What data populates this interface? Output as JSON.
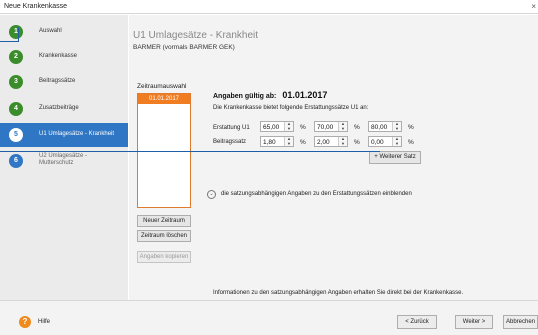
{
  "window": {
    "title": "Neue Krankenkasse",
    "close_glyph": "×"
  },
  "sidebar": {
    "items": [
      {
        "num": "1",
        "label": "Auswahl"
      },
      {
        "num": "2",
        "label": "Krankenkasse"
      },
      {
        "num": "3",
        "label": "Beitragssätze"
      },
      {
        "num": "4",
        "label": "Zusatzbeiträge"
      },
      {
        "num": "5",
        "label": "U1 Umlagesätze - Krankheit"
      },
      {
        "num": "6",
        "label": "U2 Umlagesätze - Mutterschutz"
      }
    ]
  },
  "main": {
    "title": "U1 Umlagesätze - Krankheit",
    "subtitle": "BARMER (vormals BARMER GEK)",
    "period_label": "Zeitraumauswahl",
    "periods": [
      "01.01.2017"
    ],
    "new_period_button": "Neuer Zeitraum",
    "delete_period_button": "Zeitraum löschen",
    "copy_values_button": "Angaben kopieren",
    "valid_from_label": "Angaben gültig ab:",
    "valid_from_date": "01.01.2017",
    "description": "Die Krankenkasse bietet folgende Erstattungssätze U1 an:",
    "erstattung_label": "Erstattung U1",
    "beitrag_label": "Beitragssatz",
    "erstattung_values": [
      "65,00",
      "70,00",
      "80,00"
    ],
    "beitrag_values": [
      "1,80",
      "2,00",
      "0,00"
    ],
    "percent_sign": "%",
    "add_rate_button": "+ Weiterer Satz",
    "expander_text": "die satzungsabhängigen Angaben zu den Erstattungssätzen einblenden",
    "info_text": "Informationen zu den satzungsabhängigen Angaben erhalten Sie direkt bei der Krankenkasse."
  },
  "footer": {
    "help_label": "Hilfe",
    "back_button": "< Zurück",
    "next_button": "Weiter >",
    "cancel_button": "Abbrechen"
  },
  "colors": {
    "accent": "#2f76c4",
    "step_done": "#3b8c2a",
    "period_selected": "#f07d22",
    "help": "#f08a1c"
  }
}
